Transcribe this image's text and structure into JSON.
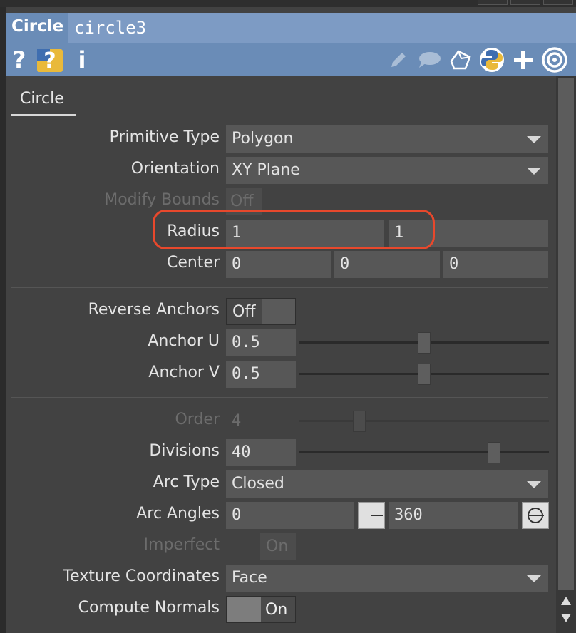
{
  "header": {
    "type_label": "Circle",
    "node_name": "circle3",
    "left_icons": [
      "help-icon",
      "python-help-icon",
      "info-icon"
    ],
    "right_icons": [
      "pencil-icon",
      "comment-icon",
      "clone-icon",
      "python-icon",
      "plus-icon",
      "target-icon"
    ]
  },
  "tabs": [
    {
      "label": "Circle"
    }
  ],
  "params": {
    "primitive_type": {
      "label": "Primitive Type",
      "value": "Polygon"
    },
    "orientation": {
      "label": "Orientation",
      "value": "XY Plane"
    },
    "modify_bounds": {
      "label": "Modify Bounds",
      "value": "Off"
    },
    "radius": {
      "label": "Radius",
      "values": [
        "1",
        "1"
      ]
    },
    "center": {
      "label": "Center",
      "values": [
        "0",
        "0",
        "0"
      ]
    },
    "reverse_anchors": {
      "label": "Reverse Anchors",
      "value": "Off"
    },
    "anchor_u": {
      "label": "Anchor U",
      "value": "0.5",
      "level": 0.5
    },
    "anchor_v": {
      "label": "Anchor V",
      "value": "0.5",
      "level": 0.5
    },
    "order": {
      "label": "Order",
      "value": "4",
      "level": 0.24
    },
    "divisions": {
      "label": "Divisions",
      "value": "40",
      "level": 0.78
    },
    "arc_type": {
      "label": "Arc Type",
      "value": "Closed"
    },
    "arc_angles": {
      "label": "Arc Angles",
      "values": [
        "0",
        "360"
      ]
    },
    "imperfect": {
      "label": "Imperfect",
      "value": "On"
    },
    "texture_coordinates": {
      "label": "Texture Coordinates",
      "value": "Face"
    },
    "compute_normals": {
      "label": "Compute Normals",
      "value": "On"
    }
  },
  "colors": {
    "header": "#6a8cb7",
    "panel": "#424242",
    "highlight": "#e8482c"
  }
}
